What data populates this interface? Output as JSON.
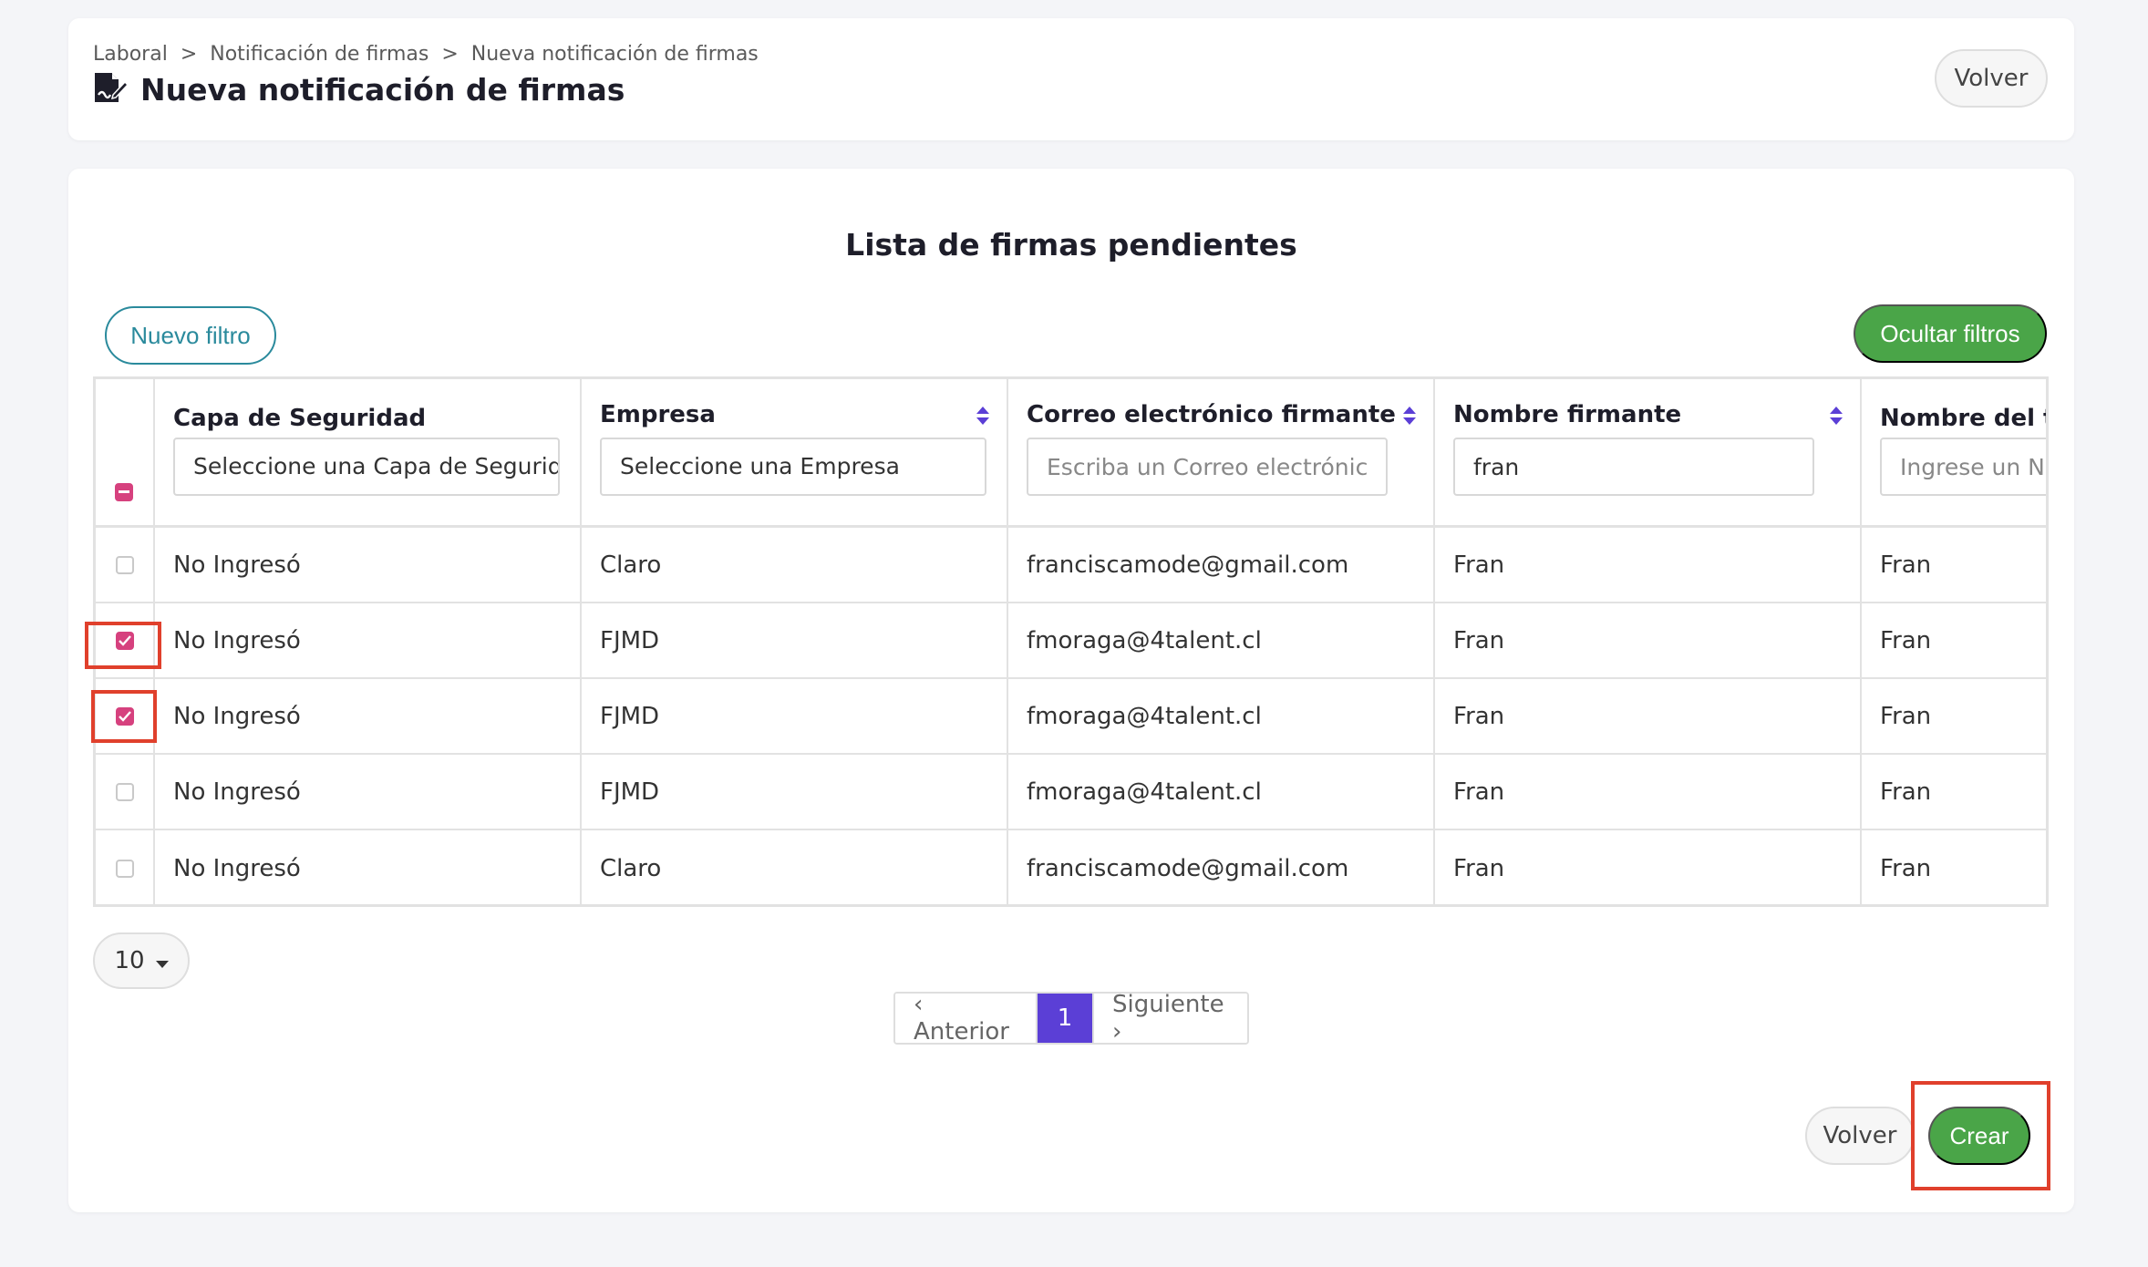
{
  "breadcrumb": {
    "items": [
      "Laboral",
      "Notificación de firmas",
      "Nueva notificación de firmas"
    ],
    "separator": ">"
  },
  "page": {
    "title": "Nueva notificación de firmas",
    "icon": "signature-document-icon",
    "back_label": "Volver"
  },
  "list": {
    "title": "Lista de firmas pendientes",
    "new_filter_label": "Nuevo filtro",
    "hide_filters_label": "Ocultar filtros"
  },
  "table": {
    "columns": [
      {
        "label": "Capa de Seguridad",
        "filter_value": "Seleccione una Capa de Seguridad",
        "filter_type": "select",
        "sortable": false
      },
      {
        "label": "Empresa",
        "filter_value": "Seleccione una Empresa",
        "filter_type": "select",
        "sortable": true
      },
      {
        "label": "Correo electrónico firmante",
        "filter_placeholder": "Escriba un Correo electrónico",
        "filter_type": "input",
        "sortable": true
      },
      {
        "label": "Nombre firmante",
        "filter_value": "fran",
        "filter_type": "input",
        "sortable": true
      },
      {
        "label": "Nombre del trabajador",
        "filter_placeholder": "Ingrese un Nombre",
        "filter_type": "input",
        "sortable": false
      }
    ],
    "rows": [
      {
        "checked": false,
        "capa": "No Ingresó",
        "empresa": "Claro",
        "correo": "franciscamode@gmail.com",
        "nombre": "Fran",
        "trabajador": "Fran"
      },
      {
        "checked": true,
        "capa": "No Ingresó",
        "empresa": "FJMD",
        "correo": "fmoraga@4talent.cl",
        "nombre": "Fran",
        "trabajador": "Fran"
      },
      {
        "checked": true,
        "capa": "No Ingresó",
        "empresa": "FJMD",
        "correo": "fmoraga@4talent.cl",
        "nombre": "Fran",
        "trabajador": "Fran"
      },
      {
        "checked": false,
        "capa": "No Ingresó",
        "empresa": "FJMD",
        "correo": "fmoraga@4talent.cl",
        "nombre": "Fran",
        "trabajador": "Fran"
      },
      {
        "checked": false,
        "capa": "No Ingresó",
        "empresa": "Claro",
        "correo": "franciscamode@gmail.com",
        "nombre": "Fran",
        "trabajador": "Fran"
      }
    ]
  },
  "pagination": {
    "page_size": "10",
    "prev_label": "‹ Anterior",
    "current_page": "1",
    "next_label": "Siguiente ›"
  },
  "footer": {
    "back_label": "Volver",
    "create_label": "Crear"
  },
  "colors": {
    "accent_green": "#4aa548",
    "accent_teal": "#2a8a9c",
    "checkbox_pink": "#d6417e",
    "pagination_purple": "#5b3fd6",
    "highlight_red": "#e0402c",
    "sort_purple": "#5b3fd6"
  }
}
